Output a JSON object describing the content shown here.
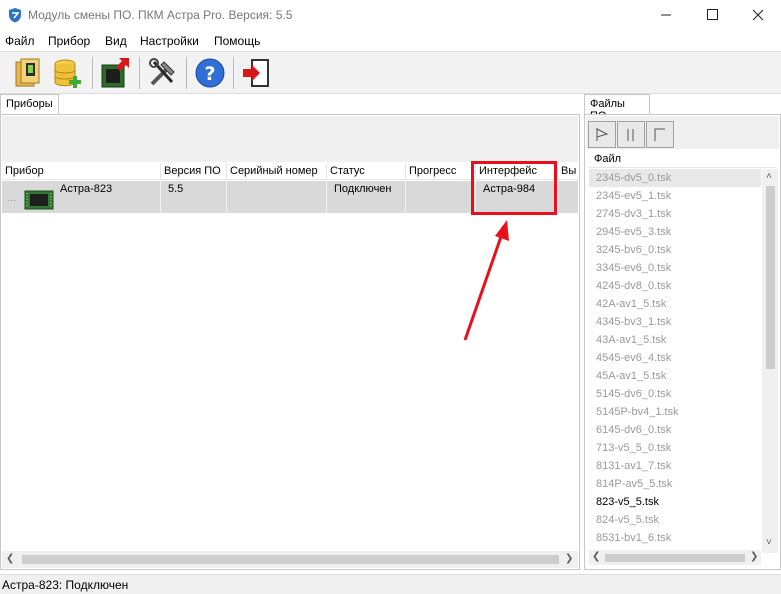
{
  "window": {
    "title": "Модуль смены ПО. ПКМ Астра Pro. Версия: 5.5"
  },
  "menu": [
    "Файл",
    "Прибор",
    "Вид",
    "Настройки",
    "Помощь"
  ],
  "toolbar": {
    "icons": [
      "open-device-icon",
      "add-database-icon",
      "flash-chip-icon",
      "tools-icon",
      "help-icon",
      "exit-icon"
    ]
  },
  "left_tab": {
    "label": "Приборы"
  },
  "devices_table": {
    "columns": [
      "Прибор",
      "Версия ПО",
      "Серийный номер",
      "Статус",
      "Прогресс",
      "Интерфейс",
      "Вы"
    ],
    "rows": [
      {
        "device": "Астра-823",
        "version": "5.5",
        "serial": "",
        "status": "Подключен",
        "progress": "",
        "interface": "Астра-984"
      }
    ]
  },
  "right_tab": {
    "label": "Файлы ПО"
  },
  "files_panel": {
    "header": "Файл",
    "files": [
      "2345-dv5_0.tsk",
      "2345-ev5_1.tsk",
      "2745-dv3_1.tsk",
      "2945-ev5_3.tsk",
      "3245-bv6_0.tsk",
      "3345-ev6_0.tsk",
      "4245-dv8_0.tsk",
      "42A-av1_5.tsk",
      "4345-bv3_1.tsk",
      "43A-av1_5.tsk",
      "4545-ev6_4.tsk",
      "45A-av1_5.tsk",
      "5145-dv6_0.tsk",
      "5145P-bv4_1.tsk",
      "6145-dv6_0.tsk",
      "713-v5_5_0.tsk",
      "8131-av1_7.tsk",
      "814P-av5_5.tsk",
      "823-v5_5.tsk",
      "824-v5_5.tsk",
      "8531-bv1_6.tsk"
    ],
    "active_file": "823-v5_5.tsk"
  },
  "status": {
    "text": "Астра-823: Подключен"
  },
  "colors": {
    "highlight_box": "#e8101a",
    "row_selected": "#d9d9d9"
  }
}
